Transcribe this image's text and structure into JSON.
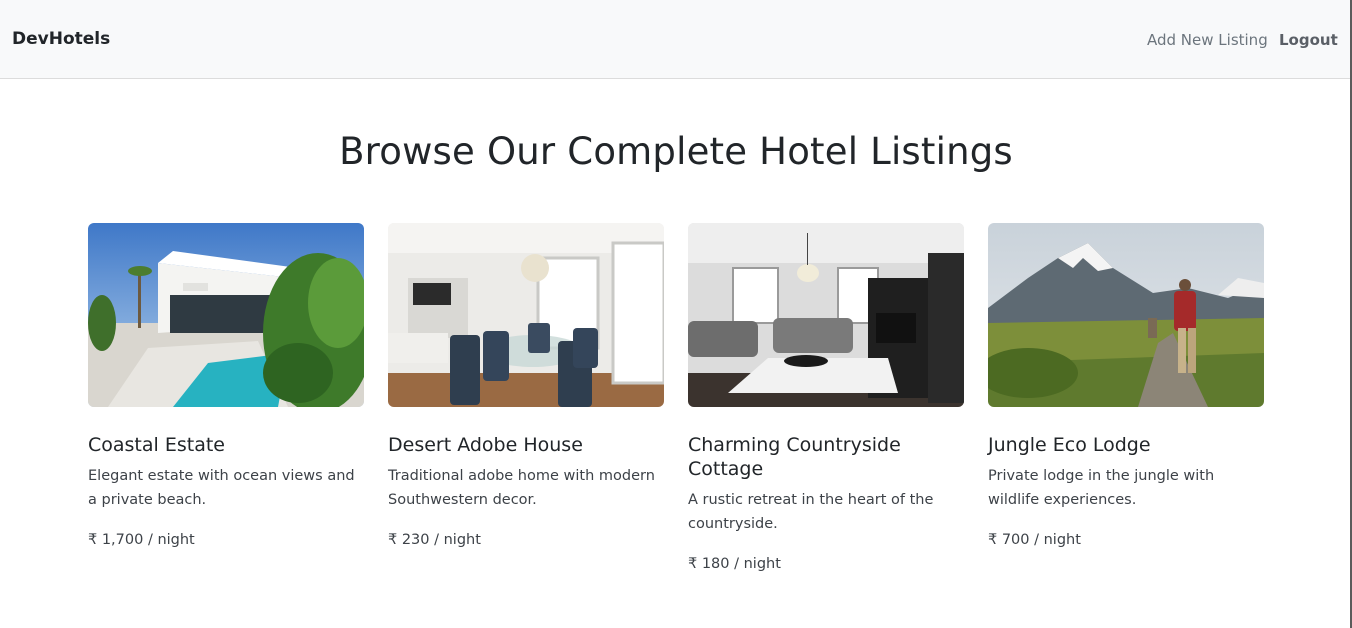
{
  "navbar": {
    "brand": "DevHotels",
    "add_listing": "Add New Listing",
    "logout": "Logout"
  },
  "page": {
    "title": "Browse Our Complete Hotel Listings"
  },
  "listings": [
    {
      "title": "Coastal Estate",
      "description": "Elegant estate with ocean views and a private beach.",
      "price": "₹ 1,700 / night",
      "image": "modern-villa-pool-photo"
    },
    {
      "title": "Desert Adobe House",
      "description": "Traditional adobe home with modern Southwestern decor.",
      "price": "₹ 230 / night",
      "image": "dining-room-interior-photo"
    },
    {
      "title": "Charming Countryside Cottage",
      "description": "A rustic retreat in the heart of the countryside.",
      "price": "₹ 180 / night",
      "image": "living-room-interior-photo"
    },
    {
      "title": "Jungle Eco Lodge",
      "description": "Private lodge in the jungle with wildlife experiences.",
      "price": "₹ 700 / night",
      "image": "mountain-hiker-photo"
    }
  ]
}
